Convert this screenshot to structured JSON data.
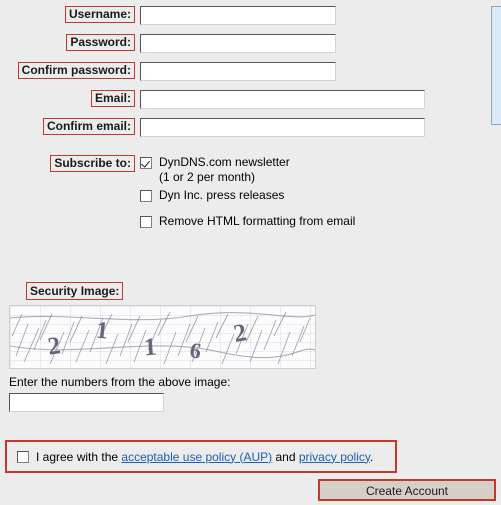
{
  "page": {
    "background_color": "#ececec",
    "accent_outline_color": "#c0392b",
    "link_color": "#1a5fb4"
  },
  "side_panel": {
    "name": "blue-panel",
    "fill_color": "#dce9f7",
    "border_color": "#8ba8c4"
  },
  "form": {
    "fields": [
      {
        "label": "Username:",
        "value": "",
        "placeholder": "",
        "width": "short"
      },
      {
        "label": "Password:",
        "value": "",
        "placeholder": "",
        "width": "short"
      },
      {
        "label": "Confirm password:",
        "value": "",
        "placeholder": "",
        "width": "short"
      },
      {
        "label": "Email:",
        "value": "",
        "placeholder": "",
        "width": "long"
      },
      {
        "label": "Confirm email:",
        "value": "",
        "placeholder": "",
        "width": "long"
      }
    ],
    "subscribe": {
      "label": "Subscribe to:",
      "options": [
        {
          "text": "DynDNS.com newsletter",
          "checked": true,
          "note": "(1 or 2 per month)"
        },
        {
          "text": "Dyn Inc. press releases",
          "checked": false,
          "note": ""
        },
        {
          "text": "Remove HTML formatting from email",
          "checked": false,
          "note": ""
        }
      ]
    }
  },
  "captcha": {
    "label": "Security Image:",
    "digits": "21162",
    "digit_list": [
      "2",
      "1",
      "1",
      "6",
      "2"
    ],
    "prompt": "Enter the numbers from the above image:",
    "input_value": "",
    "input_placeholder": ""
  },
  "agreement": {
    "checked": false,
    "text_before": "I agree with the ",
    "link1": "acceptable use policy (AUP)",
    "text_middle": " and ",
    "link2": "privacy policy",
    "text_after": "."
  },
  "submit": {
    "label": "Create Account"
  }
}
